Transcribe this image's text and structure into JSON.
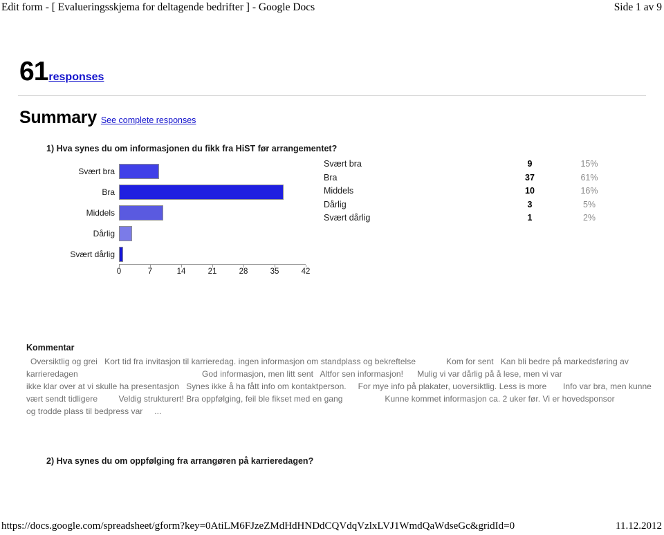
{
  "print_header": {
    "left": "Edit form - [ Evalueringsskjema for deltagende bedrifter ] - Google Docs",
    "right": "Side 1 av 9"
  },
  "print_footer": {
    "url": "https://docs.google.com/spreadsheet/gform?key=0AtiLM6FJzeZMdHdHNDdCQVdqVzlxLVJ1WmdQaWdseGc&gridId=0",
    "date": "11.12.2012"
  },
  "summary": {
    "response_number": "61",
    "responses_link": "responses",
    "title": "Summary",
    "complete_link": "See complete responses"
  },
  "questions": [
    {
      "title": "1) Hva synes du om informasjonen du fikk fra HiST før arrangementet?"
    },
    {
      "title": "2) Hva synes du om oppfølging fra arrangøren på karrieredagen?"
    }
  ],
  "stats": [
    {
      "label": "Svært bra",
      "count": "9",
      "pct": "15%"
    },
    {
      "label": "Bra",
      "count": "37",
      "pct": "61%"
    },
    {
      "label": "Middels",
      "count": "10",
      "pct": "16%"
    },
    {
      "label": "Dårlig",
      "count": "3",
      "pct": "5%"
    },
    {
      "label": "Svært dårlig",
      "count": "1",
      "pct": "2%"
    }
  ],
  "comments": {
    "heading": "Kommentar",
    "lines": [
      "Oversiktlig og grei   Kort tid fra invitasjon til karrieredag. ingen informasjon om standplass og bekreftelse             Kom for sent   Kan bli bedre på markedsføring av",
      "karrieredagen                                                     God informasjon, men litt sent   Altfor sen informasjon!      Mulig vi var dårlig på å lese, men vi var",
      "ikke klar over at vi skulle ha presentasjon   Synes ikke å ha fått info om kontaktperson.     For mye info på plakater, uoversiktlig. Less is more       Info var bra, men kunne",
      "vært sendt tidligere         Veldig strukturert! Bra oppfølging, feil ble fikset med en gang                  Kunne kommet informasjon ca. 2 uker før. Vi er hovedsponsor",
      "og trodde plass til bedpress var     ..."
    ]
  },
  "chart_data": {
    "type": "bar",
    "orientation": "horizontal",
    "title": "",
    "xlabel": "",
    "ylabel": "",
    "categories": [
      "Svært bra",
      "Bra",
      "Middels",
      "Dårlig",
      "Svært dårlig"
    ],
    "values": [
      9,
      37,
      10,
      3,
      1
    ],
    "xlim": [
      0,
      42
    ],
    "ticks": [
      "0",
      "7",
      "14",
      "21",
      "28",
      "35",
      "42"
    ],
    "grid": false,
    "legend": "none",
    "bar_colors": [
      "#4040e8",
      "#1f1fe0",
      "#5a5ae0",
      "#7b7be8",
      "#1515d8"
    ]
  }
}
